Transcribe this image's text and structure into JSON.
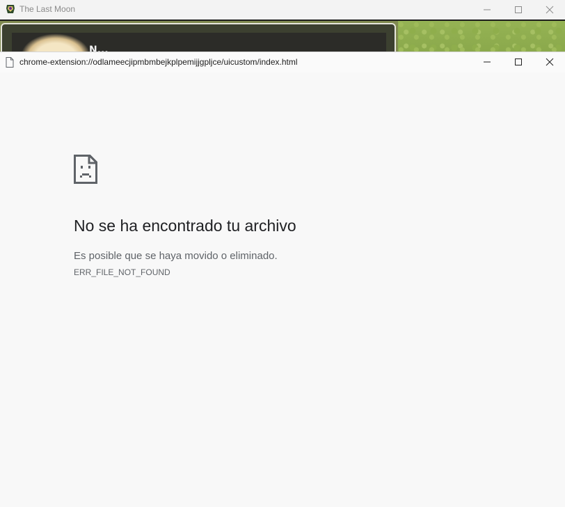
{
  "background_window": {
    "title": "The Last Moon",
    "game_partial_name": "N..."
  },
  "popup": {
    "url": "chrome-extension://odlameecjipmbmbejkplpemijjgpljce/uicustom/index.html"
  },
  "error": {
    "heading": "No se ha encontrado tu archivo",
    "message": "Es posible que se haya movido o eliminado.",
    "code": "ERR_FILE_NOT_FOUND"
  },
  "icons": {
    "app": "game-app-icon",
    "page": "document-icon",
    "error": "sad-file-icon",
    "minimize": "minimize-icon",
    "maximize": "maximize-icon",
    "close": "close-icon"
  }
}
